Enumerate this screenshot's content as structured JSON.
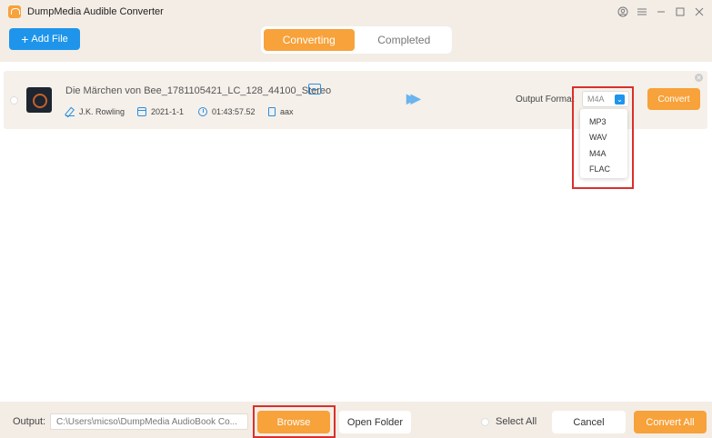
{
  "app": {
    "title": "DumpMedia Audible Converter"
  },
  "toolbar": {
    "add_file_label": "Add File"
  },
  "tabs": [
    {
      "label": "Converting",
      "active": true
    },
    {
      "label": "Completed",
      "active": false
    }
  ],
  "file": {
    "name": "Die Märchen von Bee_1781105421_LC_128_44100_Stereo",
    "author": "J.K. Rowling",
    "date": "2021-1-1",
    "duration": "01:43:57.52",
    "format": "aax",
    "output_format_label": "Output Format",
    "selected_format": "M4A",
    "convert_label": "Convert"
  },
  "format_options": [
    "MP3",
    "WAV",
    "M4A",
    "FLAC"
  ],
  "bottom": {
    "output_label": "Output:",
    "output_path": "C:\\Users\\micso\\DumpMedia AudioBook Co...",
    "browse_label": "Browse",
    "open_folder_label": "Open Folder",
    "select_all_label": "Select All",
    "cancel_label": "Cancel",
    "convert_all_label": "Convert All"
  },
  "colors": {
    "accent": "#f7a23a",
    "blue": "#1e95ea",
    "highlight": "#d9302c"
  }
}
